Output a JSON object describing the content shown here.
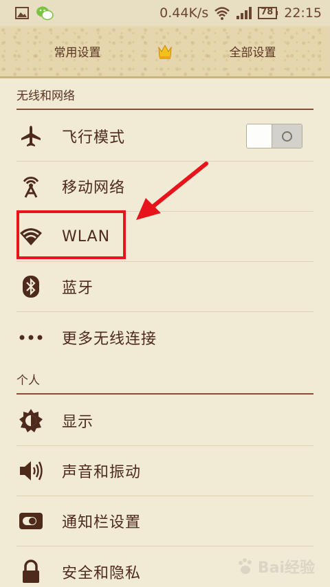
{
  "status_bar": {
    "net_speed": "0.44K/s",
    "battery": "78",
    "time": "22:15"
  },
  "tabs": {
    "left": "常用设置",
    "right": "全部设置"
  },
  "sections": [
    {
      "title": "无线和网络",
      "items": [
        {
          "label": "飞行模式",
          "icon": "airplane-icon"
        },
        {
          "label": "移动网络",
          "icon": "cell-tower-icon"
        },
        {
          "label": "WLAN",
          "icon": "wifi-icon"
        },
        {
          "label": "蓝牙",
          "icon": "bluetooth-icon"
        },
        {
          "label": "更多无线连接",
          "icon": "more-dots-icon"
        }
      ]
    },
    {
      "title": "个人",
      "items": [
        {
          "label": "显示",
          "icon": "brightness-icon"
        },
        {
          "label": "声音和振动",
          "icon": "speaker-icon"
        },
        {
          "label": "通知栏设置",
          "icon": "notification-toggle-icon"
        },
        {
          "label": "安全和隐私",
          "icon": "lock-icon"
        }
      ]
    }
  ],
  "airplane_mode_on": false,
  "watermark": "Bai经验",
  "colors": {
    "accent": "#8b4a36",
    "background": "#f1ead5",
    "highlight": "#e8141b"
  }
}
